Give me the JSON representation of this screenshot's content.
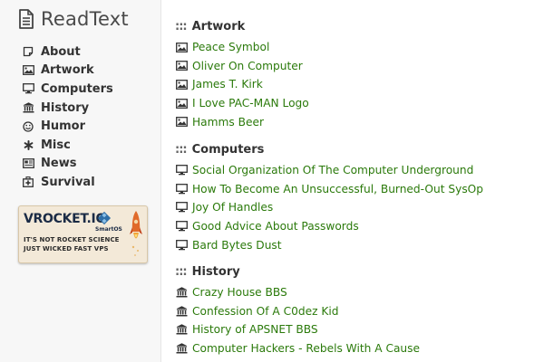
{
  "brand": {
    "name": "ReadText",
    "icon": "document-icon"
  },
  "sidebar": {
    "items": [
      {
        "label": "About",
        "icon": "note-icon"
      },
      {
        "label": "Artwork",
        "icon": "image-icon"
      },
      {
        "label": "Computers",
        "icon": "monitor-icon"
      },
      {
        "label": "History",
        "icon": "museum-icon"
      },
      {
        "label": "Humor",
        "icon": "smile-icon"
      },
      {
        "label": "Misc",
        "icon": "asterisk-icon"
      },
      {
        "label": "News",
        "icon": "newspaper-icon"
      },
      {
        "label": "Survival",
        "icon": "medkit-icon"
      }
    ]
  },
  "ad": {
    "title": "VROCKET.IO",
    "badge": "SmartOS",
    "line1": "IT'S NOT ROCKET SCIENCE",
    "line2": "JUST WICKED FAST VPS"
  },
  "sections": [
    {
      "marker": ":::",
      "title": "Artwork",
      "icon": "image-icon",
      "items": [
        "Peace Symbol",
        "Oliver On Computer",
        "James T. Kirk",
        "I Love PAC-MAN Logo",
        "Hamms Beer"
      ]
    },
    {
      "marker": ":::",
      "title": "Computers",
      "icon": "monitor-icon",
      "items": [
        "Social Organization Of The Computer Underground",
        "How To Become An Unsuccessful, Burned-Out SysOp",
        "Joy Of Handles",
        "Good Advice About Passwords",
        "Bard Bytes Dust"
      ]
    },
    {
      "marker": ":::",
      "title": "History",
      "icon": "museum-icon",
      "items": [
        "Crazy House BBS",
        "Confession Of A C0dez Kid",
        "History of APSNET BBS",
        "Computer Hackers - Rebels With A Cause"
      ]
    }
  ],
  "colors": {
    "link": "#2b7a0b",
    "sidebar_bg": "#f7f7f7"
  }
}
